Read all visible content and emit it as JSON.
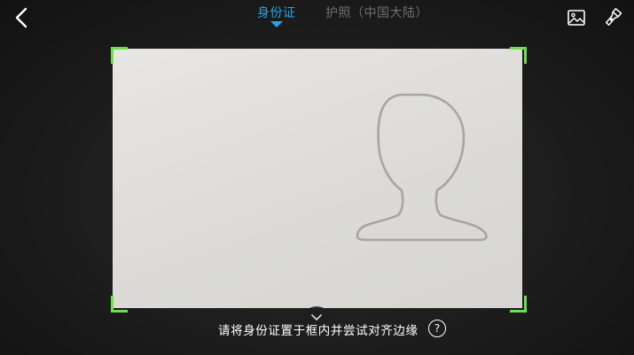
{
  "header": {
    "back_icon": "chevron-left-icon",
    "tabs": [
      {
        "label": "身份证",
        "active": true
      },
      {
        "label": "护照（中国大陆）",
        "active": false
      }
    ],
    "gallery_icon": "image-gallery-icon",
    "flash_icon": "flashlight-icon"
  },
  "viewfinder": {
    "corner_color": "#6ee14a",
    "placeholder_icon": "person-silhouette-icon"
  },
  "footer": {
    "collapse_icon": "chevron-down-icon",
    "hint": "请将身份证置于框内并尝试对齐边缘",
    "help_label": "?"
  },
  "colors": {
    "accent": "#22a6ef",
    "inactive_tab": "#6e6e6e",
    "corner": "#6ee14a"
  }
}
